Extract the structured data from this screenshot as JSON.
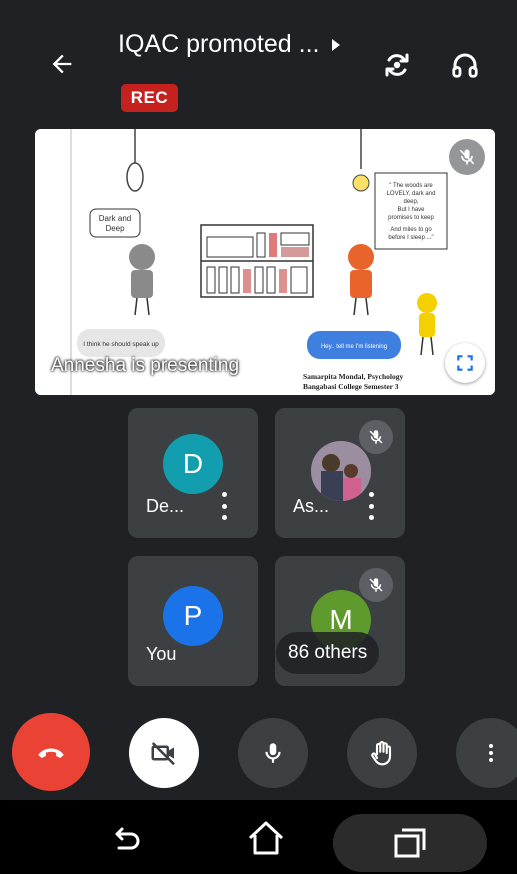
{
  "header": {
    "title": "IQAC promoted ...",
    "rec_label": "REC",
    "icons": {
      "back": "arrow-back-icon",
      "title_more": "triangle-right-icon",
      "switch_camera": "switch-camera-icon",
      "audio": "headphones-icon"
    }
  },
  "presentation": {
    "presenter_label": "Annesha is presenting",
    "slide": {
      "left_bubble": "Dark and Deep",
      "right_box_line1": "\" The woods are",
      "right_box_line2": "LOVELY, dark and",
      "right_box_line3": "deep,",
      "right_box_line4": "But I have",
      "right_box_line5": "promises to keep",
      "right_box_line6": "And miles to go",
      "right_box_line7": "before I sleep ...\"",
      "bottom_left_bubble": "I think he should speak up",
      "bottom_right_bubble": "Hey.. tell me I'm listening",
      "footer_line1": "Samarpita Mondal, Psychology",
      "footer_line2": "Bangabasi College Semester 3"
    }
  },
  "participants": [
    {
      "initial": "D",
      "name": "De...",
      "color": "#129eaf",
      "muted": false
    },
    {
      "initial": "",
      "name": "As...",
      "color": "#888888",
      "muted": true
    },
    {
      "initial": "P",
      "name": "You",
      "color": "#1a73e8",
      "muted": false
    },
    {
      "initial": "M",
      "name": "",
      "color": "#5f9b2c",
      "muted": true
    }
  ],
  "others_label": "86 others",
  "controls": {
    "end_call": "end-call-icon",
    "camera": "camera-off-icon",
    "mic": "mic-icon",
    "hand": "raise-hand-icon",
    "more": "more-vert-icon"
  },
  "colors": {
    "background": "#202124",
    "rec": "#c5221f",
    "end_call": "#ea4335"
  }
}
